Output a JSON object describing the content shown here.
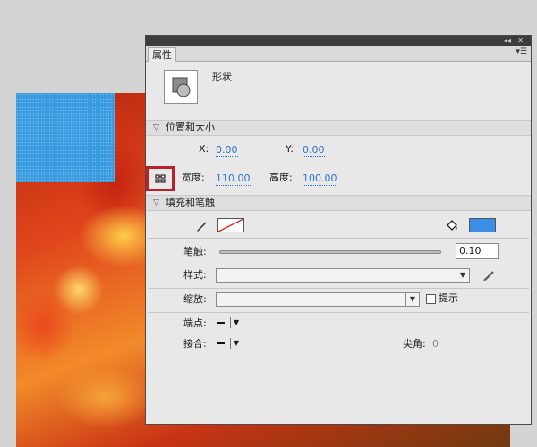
{
  "panel": {
    "tab_label": "属性",
    "shape_label": "形状"
  },
  "position_section": {
    "title": "位置和大小",
    "x_label": "X:",
    "x_value": "0.00",
    "y_label": "Y:",
    "y_value": "0.00",
    "width_label": "宽度:",
    "width_value": "110.00",
    "height_label": "高度:",
    "height_value": "100.00"
  },
  "fill_section": {
    "title": "填充和笔触",
    "fill_color": "#3b8ee8",
    "stroke_label": "笔触:",
    "stroke_value": "0.10",
    "style_label": "样式:",
    "scale_label": "缩放:",
    "hint_label": "提示",
    "cap_label": "端点:",
    "join_label": "接合:",
    "miter_label": "尖角:",
    "miter_value": "0"
  },
  "colors": {
    "highlight": "#b8202a",
    "link": "#2a74c9"
  }
}
